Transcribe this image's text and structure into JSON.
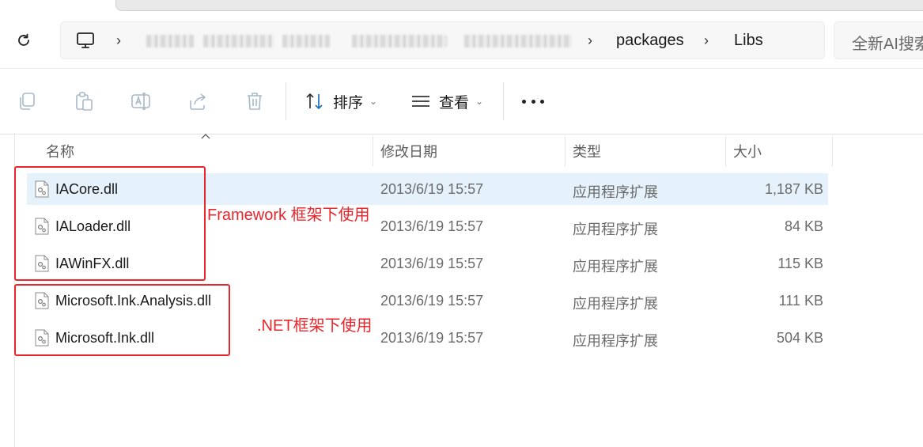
{
  "address_bar": {
    "breadcrumbs": [
      "packages",
      "Libs"
    ]
  },
  "search": {
    "placeholder": "全新AI搜索"
  },
  "toolbar": {
    "sort_label": "排序",
    "view_label": "查看"
  },
  "columns": {
    "name": "名称",
    "modified": "修改日期",
    "type": "类型",
    "size": "大小"
  },
  "files": [
    {
      "name": "IACore.dll",
      "modified": "2013/6/19 15:57",
      "type": "应用程序扩展",
      "size": "1,187 KB"
    },
    {
      "name": "IALoader.dll",
      "modified": "2013/6/19 15:57",
      "type": "应用程序扩展",
      "size": "84 KB"
    },
    {
      "name": "IAWinFX.dll",
      "modified": "2013/6/19 15:57",
      "type": "应用程序扩展",
      "size": "115 KB"
    },
    {
      "name": "Microsoft.Ink.Analysis.dll",
      "modified": "2013/6/19 15:57",
      "type": "应用程序扩展",
      "size": "111 KB"
    },
    {
      "name": "Microsoft.Ink.dll",
      "modified": "2013/6/19 15:57",
      "type": "应用程序扩展",
      "size": "504 KB"
    }
  ],
  "annotations": {
    "framework_note": "Framework 框架下使用",
    "dotnet_note": ".NET框架下使用",
    "color": "#e8262b"
  },
  "colors": {
    "selected_row": "#e5f1fb"
  }
}
